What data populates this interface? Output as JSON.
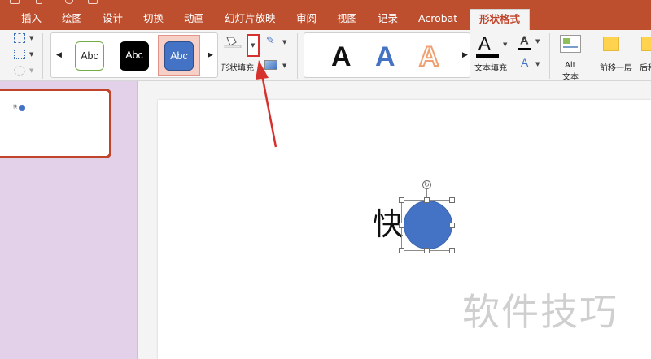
{
  "ribbon_tabs": [
    {
      "label": "插入"
    },
    {
      "label": "绘图"
    },
    {
      "label": "设计"
    },
    {
      "label": "切换"
    },
    {
      "label": "动画"
    },
    {
      "label": "幻灯片放映"
    },
    {
      "label": "审阅"
    },
    {
      "label": "视图"
    },
    {
      "label": "记录"
    },
    {
      "label": "Acrobat"
    },
    {
      "label": "形状格式",
      "active": true
    }
  ],
  "shape_styles": [
    {
      "label": "Abc",
      "style": "outline-green"
    },
    {
      "label": "Abc",
      "style": "black-fill"
    },
    {
      "label": "Abc",
      "style": "blue-fill-selected"
    }
  ],
  "shape_fill": {
    "label": "形状填充",
    "dropdown_highlighted": true
  },
  "wordart": [
    {
      "glyph": "A",
      "color": "#111111"
    },
    {
      "glyph": "A",
      "color": "#4472c4"
    },
    {
      "glyph": "A",
      "color": "#f0a070"
    }
  ],
  "text_fill": {
    "label": "文本填充"
  },
  "alt_text": {
    "label_line1": "Alt",
    "label_line2": "文本"
  },
  "bring_forward": {
    "label": "前移一层"
  },
  "send_backward": {
    "label": "后移"
  },
  "slide": {
    "text": "快",
    "shape": "circle",
    "shape_color": "#4472c4"
  },
  "thumbnail": {
    "label": "快"
  },
  "watermark": "软件技巧",
  "colors": {
    "ribbon": "#bd4f2f",
    "accent": "#c0442a",
    "panel": "#e2d1e9"
  }
}
